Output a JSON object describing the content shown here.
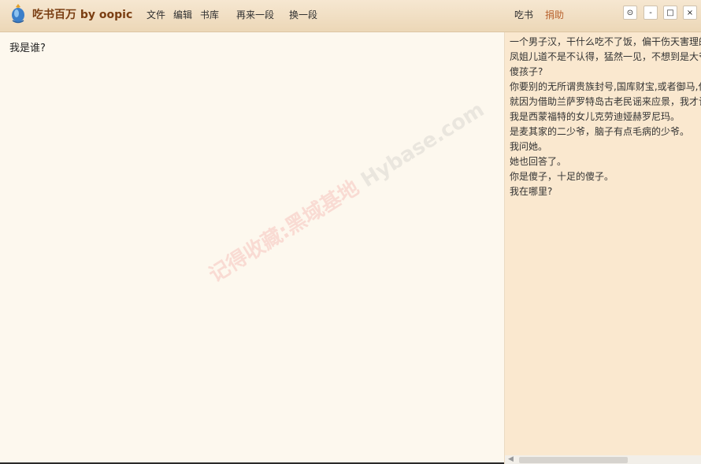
{
  "app": {
    "title": "吃书百万 by oopic"
  },
  "menu": {
    "file": "文件",
    "edit": "编辑",
    "library": "书库",
    "another_paragraph": "再来一段",
    "change_paragraph": "换一段",
    "eat_book": "吃书",
    "donate": "捐助"
  },
  "window_controls": {
    "settings": "⊙",
    "minimize": "-",
    "maximize": "□",
    "close": "×"
  },
  "editor": {
    "text": "我是谁?"
  },
  "side_panel": {
    "lines": [
      "一个男子汉，干什么吃不了饭，偏干伤天害理的",
      "凤姐儿道不是不认得，猛然一见，不想到是大爷",
      "傻孩子?",
      "你要别的无所谓贵族封号,国库财宝,或者御马,任",
      "就因为借助兰萨罗特岛古老民谣来应景，我才记",
      "我是西蒙福特的女儿克劳迪娅赫罗尼玛。",
      "是麦其家的二少爷，脑子有点毛病的少爷。",
      "我问她。",
      "她也回答了。",
      "你是傻子，十足的傻子。",
      "我在哪里?"
    ]
  },
  "watermark": {
    "text_a": "记得收藏:黑域基地",
    "text_b": "Hybase.com"
  },
  "colors": {
    "title": "#7a3e12",
    "donate": "#b8622e",
    "side_background": "#fae8cf",
    "editor_background": "#fdf8ee"
  }
}
